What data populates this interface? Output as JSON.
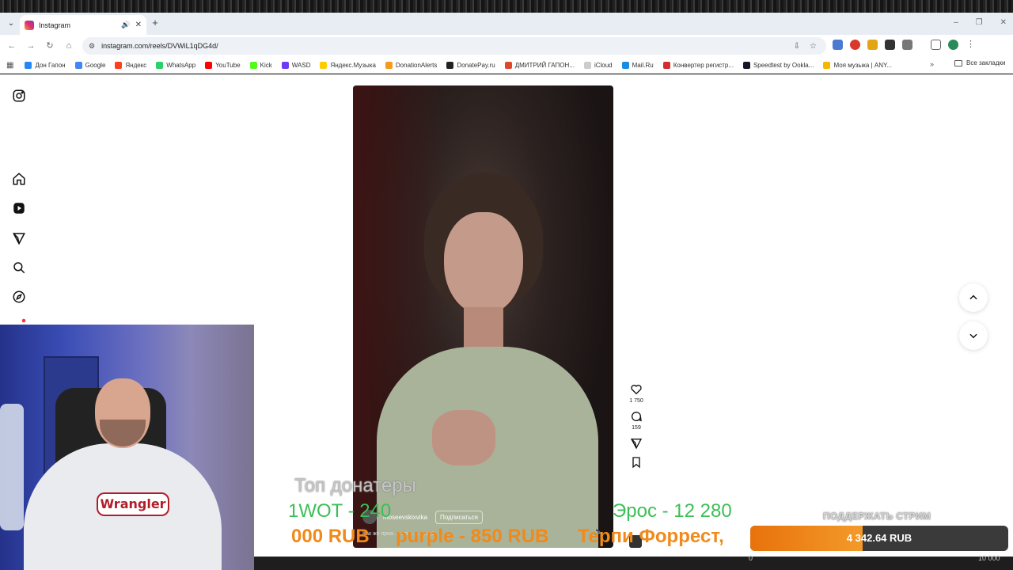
{
  "browser": {
    "tab_title": "Instagram",
    "url": "instagram.com/reels/DVWiL1qDG4d/",
    "bookmarks": [
      {
        "label": "Дон Гапон",
        "color": "#2787f5"
      },
      {
        "label": "Google",
        "color": "#4285f4"
      },
      {
        "label": "Яндекс",
        "color": "#fc3f1d"
      },
      {
        "label": "WhatsApp",
        "color": "#25d366"
      },
      {
        "label": "YouTube",
        "color": "#ff0000"
      },
      {
        "label": "Kick",
        "color": "#53fc18"
      },
      {
        "label": "WASD",
        "color": "#6a3df5"
      },
      {
        "label": "Яндекс.Музыка",
        "color": "#ffcc00"
      },
      {
        "label": "DonationAlerts",
        "color": "#f59c1a"
      },
      {
        "label": "DonatePay.ru",
        "color": "#222222"
      },
      {
        "label": "ДМИТРИЙ ГАПОН...",
        "color": "#e0482c"
      },
      {
        "label": "iCloud",
        "color": "#cccccc"
      },
      {
        "label": "Mail.Ru",
        "color": "#168de2"
      },
      {
        "label": "Конвертер регистр...",
        "color": "#d32f2f"
      },
      {
        "label": "Speedtest by Ookla...",
        "color": "#141526"
      },
      {
        "label": "Моя музыка | ANY...",
        "color": "#f5b800"
      }
    ],
    "all_bookmarks": "Все закладки"
  },
  "reel": {
    "author": "moseevskixvika",
    "follow_label": "Подписаться",
    "caption": "Как же прия... что т... ... ещё",
    "likes": "1 750",
    "comments": "159"
  },
  "overlay": {
    "top_title": "Топ донатеры",
    "line1_left": "1WOT - 240",
    "line1_right": "Эрос - 12 280",
    "line2_a": "000 RUB",
    "line2_b": "purple - 850 RUB",
    "line2_c": "Терпи Форрест,",
    "support_label": "ПОДДЕРЖАТЬ СТРИМ",
    "goal_amount": "4 342.64 RUB",
    "goal_min": "0",
    "goal_max": "10 000",
    "goal_fraction": 0.4343
  },
  "webcam": {
    "shirt_logo": "Wrangler"
  }
}
